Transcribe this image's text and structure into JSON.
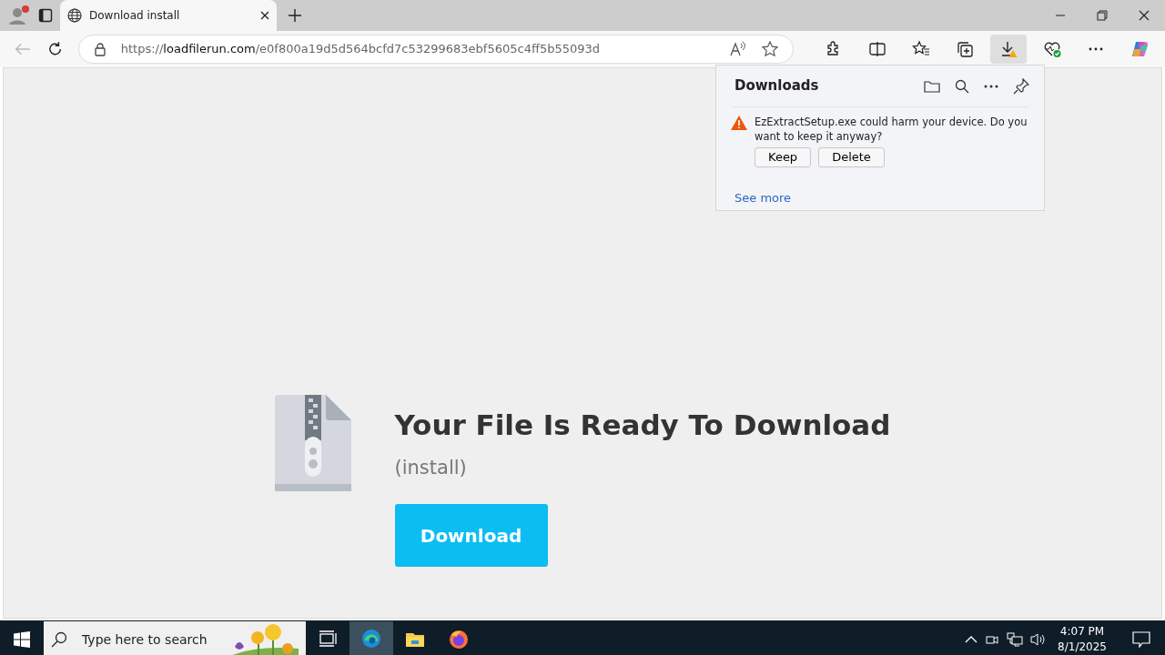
{
  "browser": {
    "tabs": [
      {
        "title": "Download install",
        "selected": true
      }
    ],
    "address": {
      "scheme": "https://",
      "host": "loadfilerun.com",
      "path": "/e0f800a19d5d564bcfd7c53299683ebf5605c4ff5b55093d"
    },
    "toolbar_buttons": [
      {
        "kind": "extensions",
        "active": false
      },
      {
        "kind": "split",
        "active": false
      },
      {
        "kind": "favorites",
        "active": false
      },
      {
        "kind": "collections",
        "active": false
      },
      {
        "kind": "downloads",
        "active": true
      },
      {
        "kind": "health",
        "active": false
      },
      {
        "kind": "more",
        "active": false
      },
      {
        "kind": "copilot",
        "active": false
      }
    ]
  },
  "downloads_panel": {
    "title": "Downloads",
    "warning": "EzExtractSetup.exe could harm your device. Do you want to keep it anyway?",
    "buttons": [
      "Keep",
      "Delete"
    ],
    "see_more": "See more"
  },
  "page": {
    "heading": "Your File Is Ready To Download",
    "subtitle": "(install)",
    "button": "Download"
  },
  "taskbar": {
    "search_placeholder": "Type here to search",
    "apps": [
      {
        "kind": "taskview",
        "selected": false
      },
      {
        "kind": "edge",
        "selected": true
      },
      {
        "kind": "explorer",
        "selected": false
      },
      {
        "kind": "firefox",
        "selected": false
      }
    ],
    "time": "4:07 PM",
    "date": "8/1/2025"
  }
}
